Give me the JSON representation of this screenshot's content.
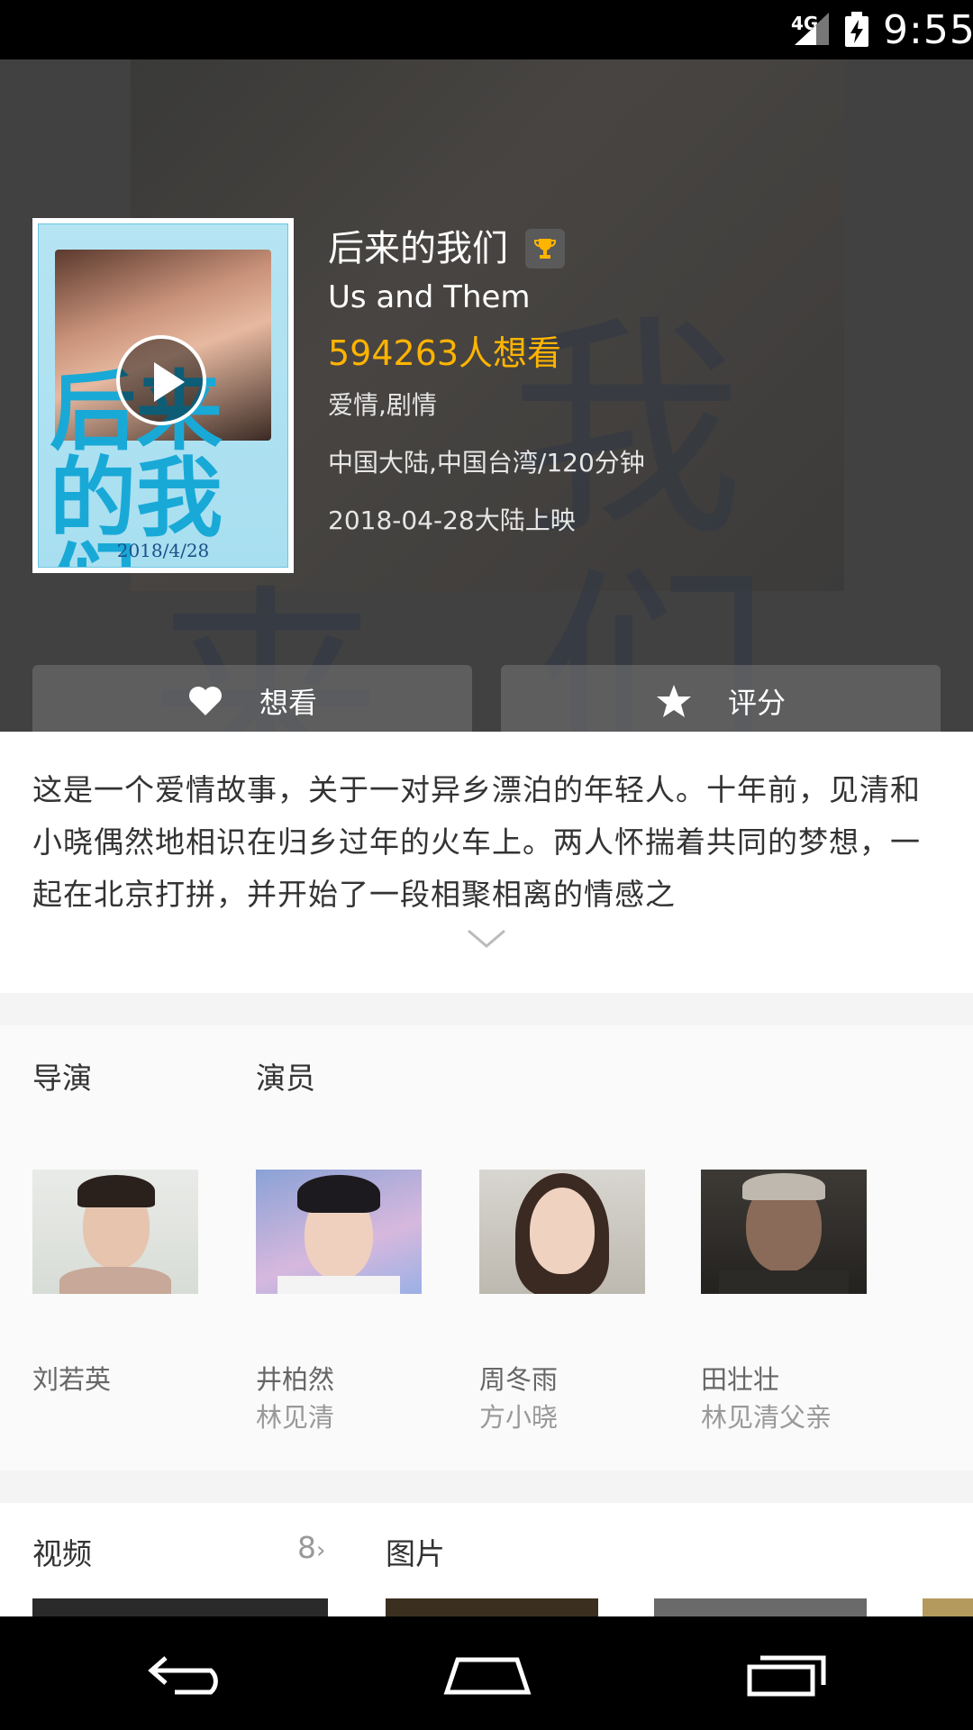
{
  "status_bar": {
    "network": "4G",
    "time": "9:55"
  },
  "movie": {
    "title_cn": "后来的我们",
    "title_en": "Us and Them",
    "want_count": "594263人想看",
    "genre": "爱情,剧情",
    "region_duration": "中国大陆,中国台湾/120分钟",
    "release": "2018-04-28大陆上映",
    "poster_date": "2018/4/28"
  },
  "actions": {
    "want_label": "想看",
    "rate_label": "评分"
  },
  "synopsis": "这是一个爱情故事，关于一对异乡漂泊的年轻人。十年前，见清和小晓偶然地相识在归乡过年的火车上。两人怀揣着共同的梦想，一起在北京打拼，并开始了一段相聚相离的情感之",
  "cast": {
    "director_label": "导演",
    "actor_label": "演员",
    "people": [
      {
        "name": "刘若英",
        "role": ""
      },
      {
        "name": "井柏然",
        "role": "林见清"
      },
      {
        "name": "周冬雨",
        "role": "方小晓"
      },
      {
        "name": "田壮壮",
        "role": "林见清父亲"
      }
    ]
  },
  "media": {
    "video_label": "视频",
    "video_count": "8",
    "image_label": "图片"
  },
  "icons": {
    "trophy": "trophy-icon",
    "heart": "heart-icon",
    "star": "star-icon",
    "play": "play-icon",
    "expand": "chevron-down-icon",
    "back": "back-icon",
    "home": "home-icon",
    "recents": "recents-icon"
  },
  "colors": {
    "accent": "#ffb400",
    "header_bg": "#414141"
  }
}
